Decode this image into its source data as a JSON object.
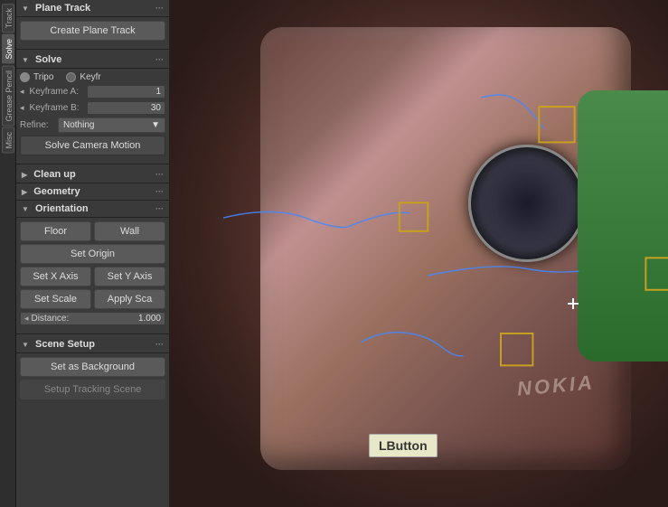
{
  "vtabs": {
    "track": "Track",
    "solve": "Solve",
    "grease_pencil": "Grease Pencil",
    "misc": "Misc"
  },
  "panel": {
    "plane_track_section": "Plane Track",
    "create_plane_track_btn": "Create Plane Track",
    "solve_section": "Solve",
    "solve_dots": "···",
    "tripo_label": "Tripo",
    "keyfr_label": "Keyfr",
    "keyframe_a_label": "Keyframe A:",
    "keyframe_a_value": "1",
    "keyframe_b_label": "Keyframe B:",
    "keyframe_b_value": "30",
    "refine_label": "Refine:",
    "refine_value": "Nothing",
    "refine_arrow": "▼",
    "solve_camera_motion_btn": "Solve Camera Motion",
    "cleanup_section": "Clean up",
    "cleanup_dots": "···",
    "geometry_section": "Geometry",
    "geometry_dots": "···",
    "orientation_section": "Orientation",
    "orientation_dots": "···",
    "floor_btn": "Floor",
    "wall_btn": "Wall",
    "set_origin_btn": "Set Origin",
    "set_x_axis_btn": "Set X Axis",
    "set_y_axis_btn": "Set Y Axis",
    "set_scale_btn": "Set Scale",
    "apply_scale_btn": "Apply Sca",
    "distance_label": "Distance:",
    "distance_value": "1.000",
    "scene_setup_section": "Scene Setup",
    "scene_setup_dots": "···",
    "set_as_background_btn": "Set as Background",
    "setup_tracking_scene_btn": "Setup Tracking Scene"
  },
  "viewport": {
    "tooltip_text": "LButton"
  },
  "colors": {
    "accent": "#c8a020",
    "panel_bg": "#3a3a3a",
    "button_bg": "#5a5a5a",
    "section_header_bg": "#3a3a3a",
    "active_tab": "#555555"
  }
}
